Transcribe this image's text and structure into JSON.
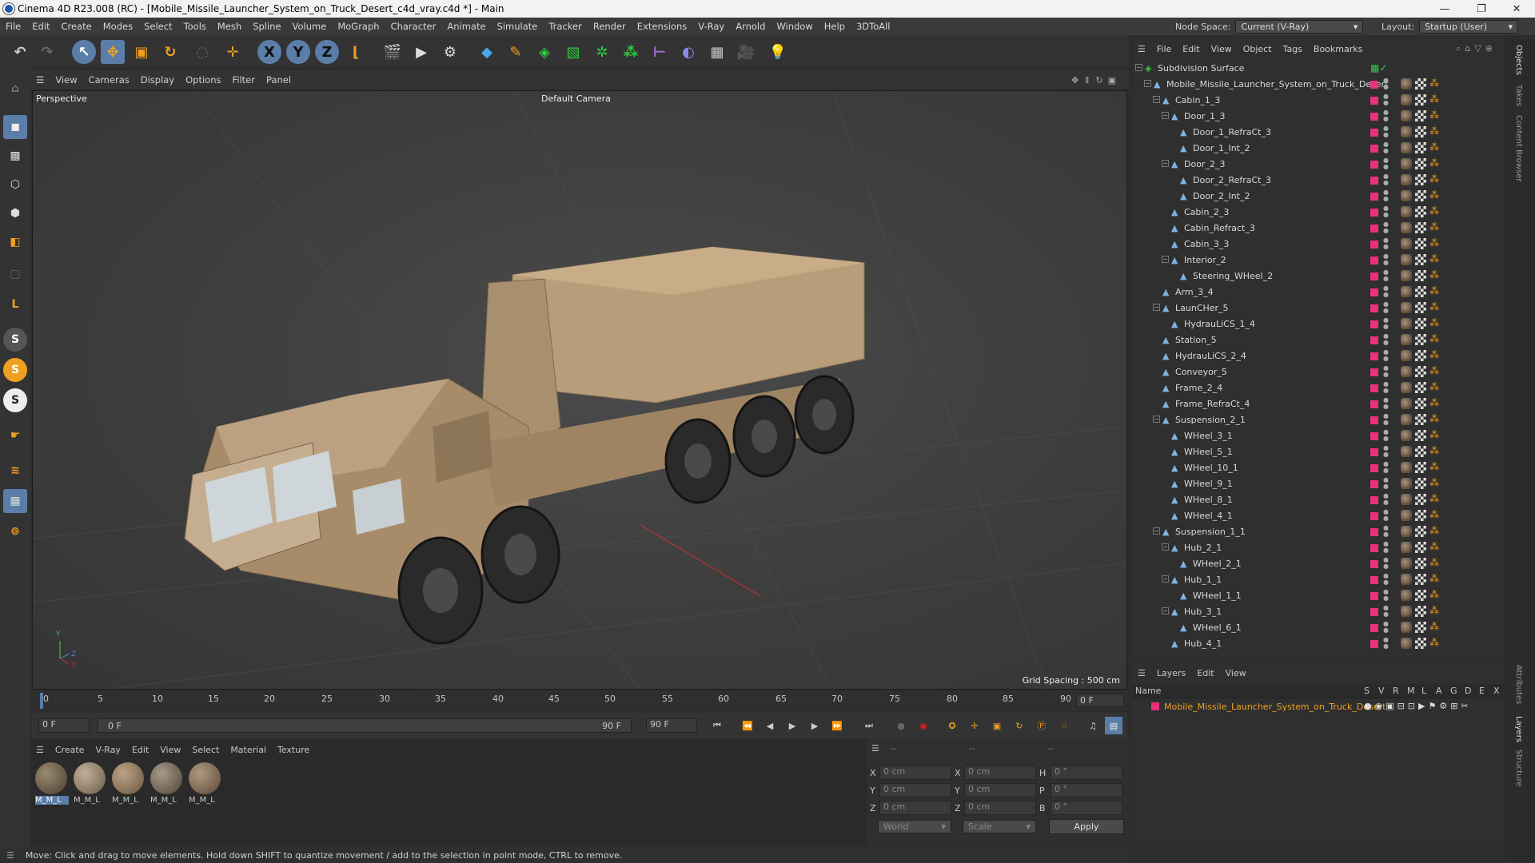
{
  "window": {
    "title": "Cinema 4D R23.008 (RC) - [Mobile_Missile_Launcher_System_on_Truck_Desert_c4d_vray.c4d *] - Main",
    "minimize": "—",
    "maximize": "❐",
    "close": "✕"
  },
  "menu": [
    "File",
    "Edit",
    "Create",
    "Modes",
    "Select",
    "Tools",
    "Mesh",
    "Spline",
    "Volume",
    "MoGraph",
    "Character",
    "Animate",
    "Simulate",
    "Tracker",
    "Render",
    "Extensions",
    "V-Ray",
    "Arnold",
    "Window",
    "Help",
    "3DToAll"
  ],
  "node_space": {
    "label": "Node Space:",
    "value": "Current (V-Ray)"
  },
  "layout": {
    "label": "Layout:",
    "value": "Startup (User)"
  },
  "viewport": {
    "menu": [
      "View",
      "Cameras",
      "Display",
      "Options",
      "Filter",
      "Panel"
    ],
    "view_name": "Perspective",
    "camera": "Default Camera",
    "grid_spacing": "Grid Spacing : 500 cm",
    "axis_y": "Y",
    "axis_z": "Z",
    "axis_x": "X"
  },
  "timeline": {
    "ticks": [
      "0",
      "5",
      "10",
      "15",
      "20",
      "25",
      "30",
      "35",
      "40",
      "45",
      "50",
      "55",
      "60",
      "65",
      "70",
      "75",
      "80",
      "85",
      "90"
    ],
    "current_frame": "0 F",
    "start": "0 F",
    "range_start": "0 F",
    "range_end": "90 F",
    "end": "90 F"
  },
  "material_panel": {
    "menu": [
      "Create",
      "V-Ray",
      "Edit",
      "View",
      "Select",
      "Material",
      "Texture"
    ],
    "materials": [
      "M_M_L",
      "M_M_L",
      "M_M_L",
      "M_M_L",
      "M_M_L"
    ]
  },
  "coords": {
    "header": [
      "--",
      "--",
      "--"
    ],
    "rows": [
      {
        "a": "X",
        "av": "0 cm",
        "b": "X",
        "bv": "0 cm",
        "c": "H",
        "cv": "0 °"
      },
      {
        "a": "Y",
        "av": "0 cm",
        "b": "Y",
        "bv": "0 cm",
        "c": "P",
        "cv": "0 °"
      },
      {
        "a": "Z",
        "av": "0 cm",
        "b": "Z",
        "bv": "0 cm",
        "c": "B",
        "cv": "0 °"
      }
    ],
    "mode1": "World",
    "mode2": "Scale",
    "apply": "Apply"
  },
  "status": "Move: Click and drag to move elements. Hold down SHIFT to quantize movement / add to the selection in point mode, CTRL to remove.",
  "object_manager": {
    "menu": [
      "File",
      "Edit",
      "View",
      "Object",
      "Tags",
      "Bookmarks"
    ],
    "objects": [
      {
        "name": "Subdivision Surface",
        "indent": 0
      },
      {
        "name": "Mobile_Missile_Launcher_System_on_Truck_Desert",
        "indent": 1
      },
      {
        "name": "Cabin_1_3",
        "indent": 2
      },
      {
        "name": "Door_1_3",
        "indent": 3
      },
      {
        "name": "Door_1_RefraCt_3",
        "indent": 4
      },
      {
        "name": "Door_1_Int_2",
        "indent": 4
      },
      {
        "name": "Door_2_3",
        "indent": 3
      },
      {
        "name": "Door_2_RefraCt_3",
        "indent": 4
      },
      {
        "name": "Door_2_Int_2",
        "indent": 4
      },
      {
        "name": "Cabin_2_3",
        "indent": 3
      },
      {
        "name": "Cabin_Refract_3",
        "indent": 3
      },
      {
        "name": "Cabin_3_3",
        "indent": 3
      },
      {
        "name": "Interior_2",
        "indent": 3
      },
      {
        "name": "Steering_WHeel_2",
        "indent": 4
      },
      {
        "name": "Arm_3_4",
        "indent": 2
      },
      {
        "name": "LaunCHer_5",
        "indent": 2
      },
      {
        "name": "HydrauLiCS_1_4",
        "indent": 3
      },
      {
        "name": "Station_5",
        "indent": 2
      },
      {
        "name": "HydrauLiCS_2_4",
        "indent": 2
      },
      {
        "name": "Conveyor_5",
        "indent": 2
      },
      {
        "name": "Frame_2_4",
        "indent": 2
      },
      {
        "name": "Frame_RefraCt_4",
        "indent": 2
      },
      {
        "name": "Suspension_2_1",
        "indent": 2
      },
      {
        "name": "WHeel_3_1",
        "indent": 3
      },
      {
        "name": "WHeel_5_1",
        "indent": 3
      },
      {
        "name": "WHeel_10_1",
        "indent": 3
      },
      {
        "name": "WHeel_9_1",
        "indent": 3
      },
      {
        "name": "WHeel_8_1",
        "indent": 3
      },
      {
        "name": "WHeel_4_1",
        "indent": 3
      },
      {
        "name": "Suspension_1_1",
        "indent": 2
      },
      {
        "name": "Hub_2_1",
        "indent": 3
      },
      {
        "name": "WHeel_2_1",
        "indent": 4
      },
      {
        "name": "Hub_1_1",
        "indent": 3
      },
      {
        "name": "WHeel_1_1",
        "indent": 4
      },
      {
        "name": "Hub_3_1",
        "indent": 3
      },
      {
        "name": "WHeel_6_1",
        "indent": 4
      },
      {
        "name": "Hub_4_1",
        "indent": 3
      }
    ]
  },
  "layers": {
    "menu": [
      "Layers",
      "Edit",
      "View"
    ],
    "name_header": "Name",
    "flags": [
      "S",
      "V",
      "R",
      "M",
      "L",
      "A",
      "G",
      "D",
      "E",
      "X"
    ],
    "layer_name": "Mobile_Missile_Launcher_System_on_Truck_Desert"
  },
  "side_tabs": [
    "Objects",
    "Takes",
    "Content Browser",
    "Attributes",
    "Layers",
    "Structure"
  ],
  "colors": {
    "accent": "#e8327a",
    "orange": "#f0a020",
    "blue": "#4aa8e8"
  }
}
